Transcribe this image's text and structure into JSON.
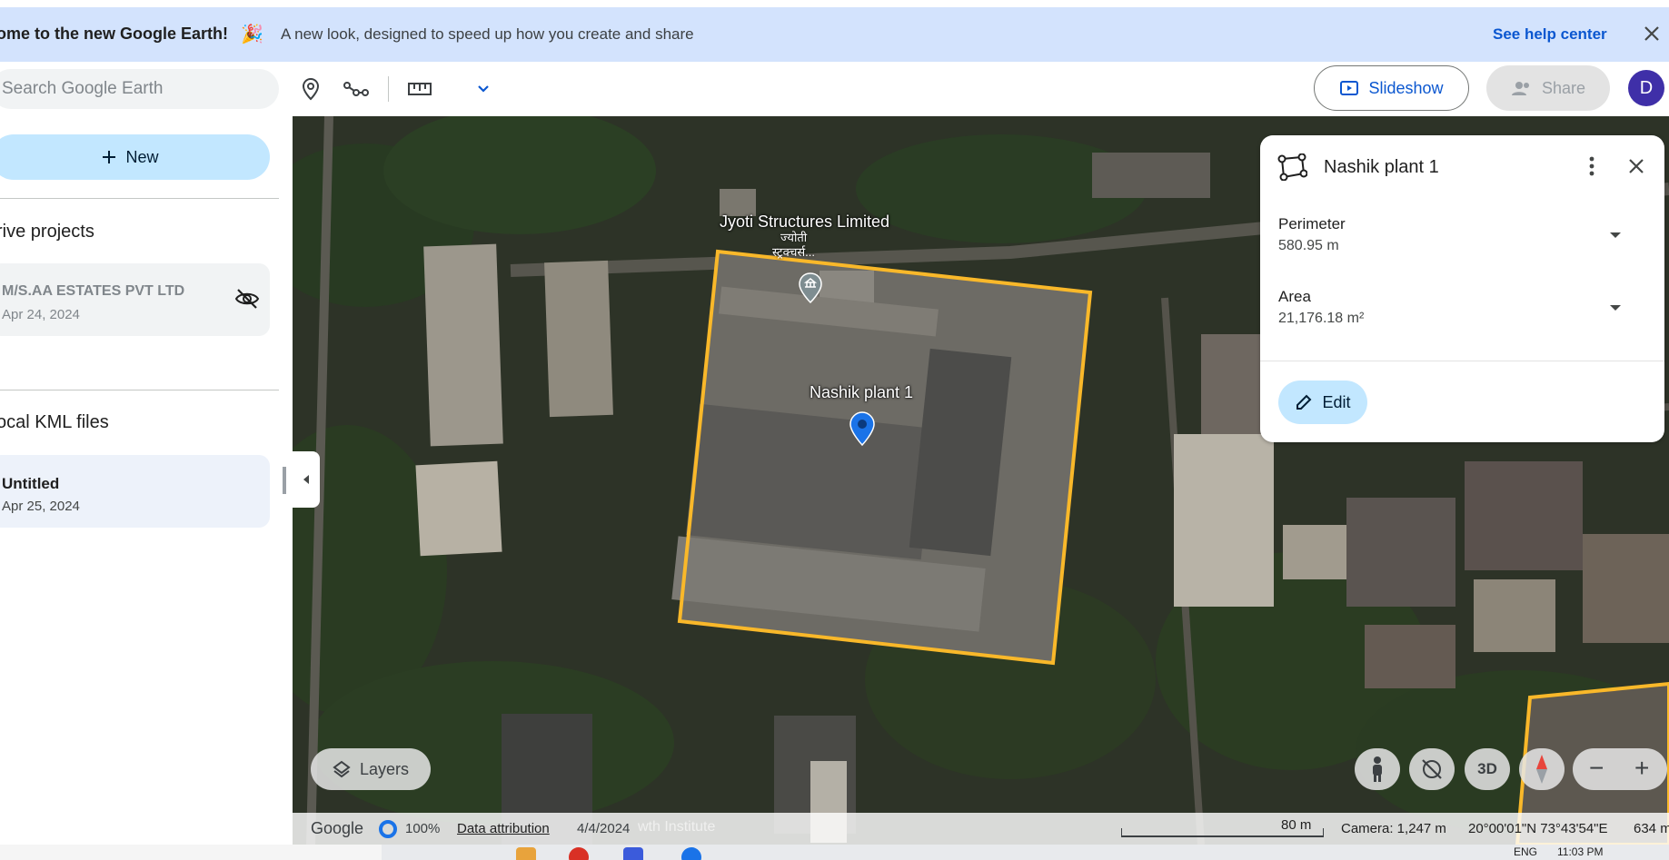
{
  "banner": {
    "welcome": "ome to the new Google Earth!",
    "party_emoji": "🎉",
    "subtitle": "A new look, designed to speed up how you create and share",
    "help_link": "See help center"
  },
  "toolbar": {
    "search_placeholder": "Search Google Earth",
    "slideshow_label": "Slideshow",
    "share_label": "Share",
    "avatar_initial": "D",
    "icons": [
      "place-marker-icon",
      "path-icon",
      "ruler-icon",
      "chevron-down-icon"
    ]
  },
  "sidebar": {
    "new_label": "New",
    "drive_section": "rive projects",
    "drive_projects": [
      {
        "name": "M/S.AA ESTATES PVT LTD",
        "date": "Apr 24, 2024",
        "hidden": true
      }
    ],
    "kml_section": "ocal KML files",
    "kml_files": [
      {
        "name": "Untitled",
        "date": "Apr 25, 2024"
      }
    ]
  },
  "map": {
    "labels": {
      "company": "Jyoti Structures Limited",
      "company_hindi_1": "ज्योती",
      "company_hindi_2": "स्ट्रक्चर्स...",
      "placemark": "Nashik plant 1"
    },
    "polygon_color": "#f9b82a",
    "pin_color": "#1a73e8"
  },
  "info_panel": {
    "title": "Nashik plant 1",
    "perimeter_label": "Perimeter",
    "perimeter_value": "580.95 m",
    "area_label": "Area",
    "area_value": "21,176.18 m²",
    "edit_label": "Edit"
  },
  "controls": {
    "layers_label": "Layers",
    "three_d_label": "3D"
  },
  "status": {
    "google": "Google",
    "percent": "100%",
    "data_attribution": "Data attribution",
    "imagery_date": "4/4/2024",
    "ghost_label": "wth Institute",
    "scale": "80 m",
    "camera": "Camera: 1,247 m",
    "coordinates": "20°00'01\"N 73°43'54\"E",
    "elevation": "634 m"
  },
  "taskbar": {
    "lang": "ENG",
    "time": "11:03 PM"
  }
}
